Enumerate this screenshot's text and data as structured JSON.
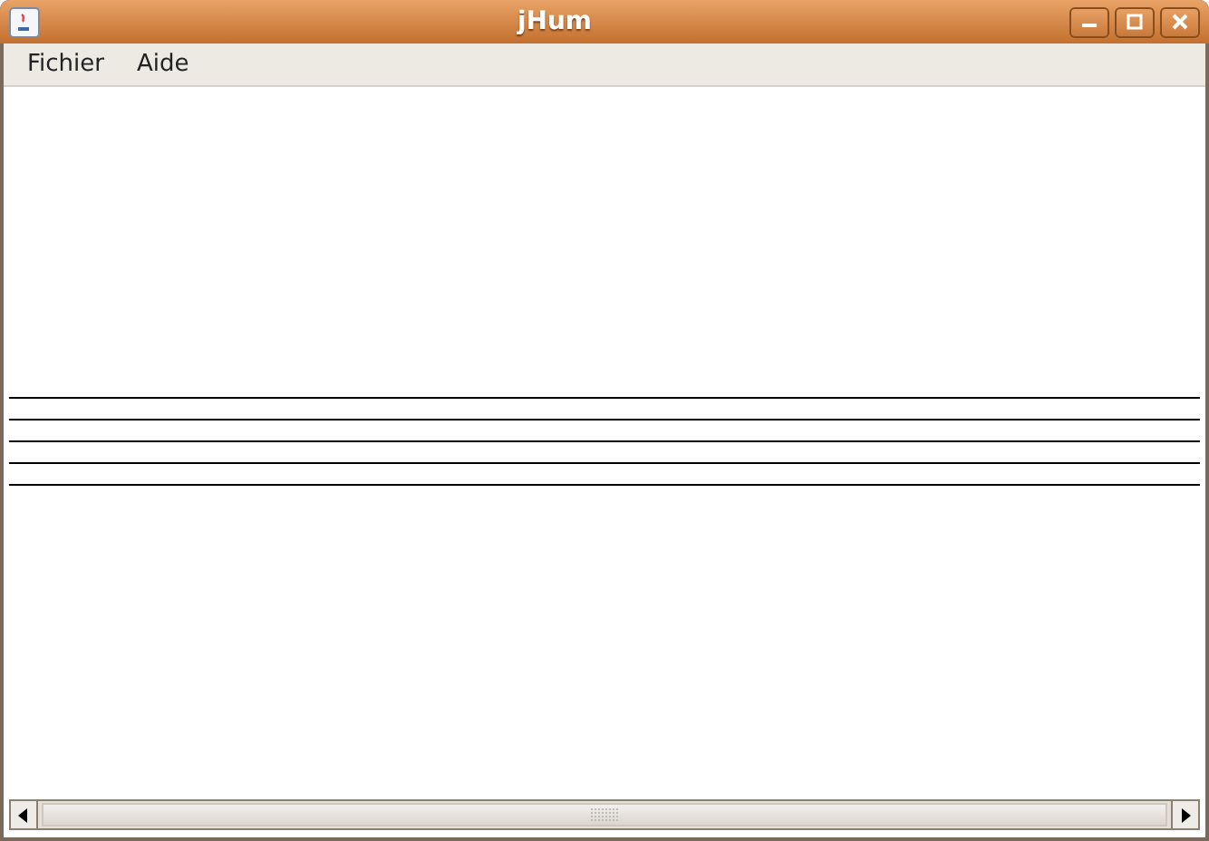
{
  "window": {
    "title": "jHum"
  },
  "menu": [
    {
      "label": "Fichier"
    },
    {
      "label": "Aide"
    }
  ]
}
